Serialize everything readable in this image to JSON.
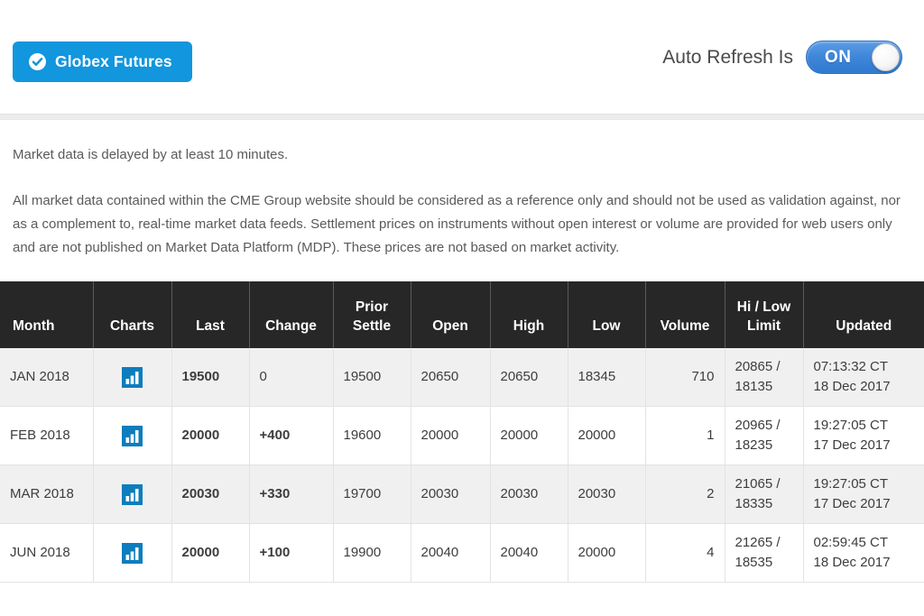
{
  "header": {
    "globex_button_label": "Globex Futures",
    "globex_icon": "check-circle-icon",
    "auto_refresh_label": "Auto Refresh Is",
    "auto_refresh_state": "ON",
    "accent_blue": "#1296dd",
    "toggle_blue": "#3f86d8"
  },
  "disclaimer": {
    "line1": "Market data is delayed by at least 10 minutes.",
    "line2": "All market data contained within the CME Group website should be considered as a reference only and should not be used as validation against, nor as a complement to, real-time market data feeds. Settlement prices on instruments without open interest or volume are provided for web users only and are not published on Market Data Platform (MDP). These prices are not based on market activity."
  },
  "table": {
    "columns": [
      "Month",
      "Charts",
      "Last",
      "Change",
      "Prior Settle",
      "Open",
      "High",
      "Low",
      "Volume",
      "Hi / Low Limit",
      "Updated"
    ],
    "column_prior_settle_line1": "Prior",
    "column_prior_settle_line2": "Settle",
    "column_hilow_line1": "Hi / Low",
    "column_hilow_line2": "Limit",
    "change_up_color": "#1f9c35",
    "rows": [
      {
        "month": "JAN 2018",
        "chart_icon": "bar-chart-icon",
        "last": "19500",
        "change": "0",
        "change_dir": "flat",
        "prior_settle": "19500",
        "open": "20650",
        "high": "20650",
        "low": "18345",
        "volume": "710",
        "limit_hi": "20865 /",
        "limit_lo": "18135",
        "updated_time": "07:13:32 CT",
        "updated_date": "18 Dec 2017"
      },
      {
        "month": "FEB 2018",
        "chart_icon": "bar-chart-icon",
        "last": "20000",
        "change": "+400",
        "change_dir": "up",
        "prior_settle": "19600",
        "open": "20000",
        "high": "20000",
        "low": "20000",
        "volume": "1",
        "limit_hi": "20965 /",
        "limit_lo": "18235",
        "updated_time": "19:27:05 CT",
        "updated_date": "17 Dec 2017"
      },
      {
        "month": "MAR 2018",
        "chart_icon": "bar-chart-icon",
        "last": "20030",
        "change": "+330",
        "change_dir": "up",
        "prior_settle": "19700",
        "open": "20030",
        "high": "20030",
        "low": "20030",
        "volume": "2",
        "limit_hi": "21065 /",
        "limit_lo": "18335",
        "updated_time": "19:27:05 CT",
        "updated_date": "17 Dec 2017"
      },
      {
        "month": "JUN 2018",
        "chart_icon": "bar-chart-icon",
        "last": "20000",
        "change": "+100",
        "change_dir": "up",
        "prior_settle": "19900",
        "open": "20040",
        "high": "20040",
        "low": "20000",
        "volume": "4",
        "limit_hi": "21265 /",
        "limit_lo": "18535",
        "updated_time": "02:59:45 CT",
        "updated_date": "18 Dec 2017"
      }
    ]
  }
}
